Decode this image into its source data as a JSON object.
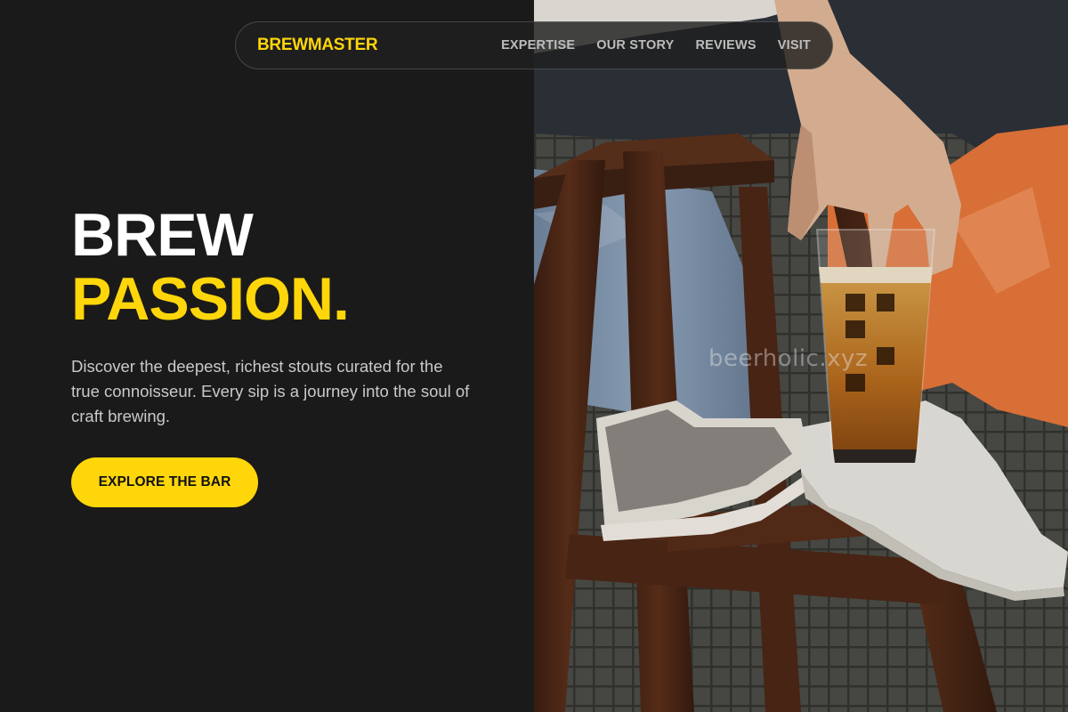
{
  "nav": {
    "logo": "BREWMASTER",
    "links": [
      {
        "label": "EXPERTISE"
      },
      {
        "label": "OUR STORY"
      },
      {
        "label": "REVIEWS"
      },
      {
        "label": "VISIT"
      }
    ]
  },
  "hero": {
    "title_line1": "BREW",
    "title_line2": "PASSION.",
    "description": "Discover the deepest, richest stouts curated for the true connoisseur. Every sip is a journey into the soul of craft brewing.",
    "cta_label": "EXPLORE THE BAR"
  },
  "photo": {
    "watermark": "beerholic.xyz",
    "alt": "Person seated on a wooden bar stool holding a glass of beer"
  },
  "colors": {
    "accent": "#ffd60a",
    "background": "#1b1a1a",
    "text_light": "#ffffff",
    "text_muted": "#c9c9c9"
  }
}
